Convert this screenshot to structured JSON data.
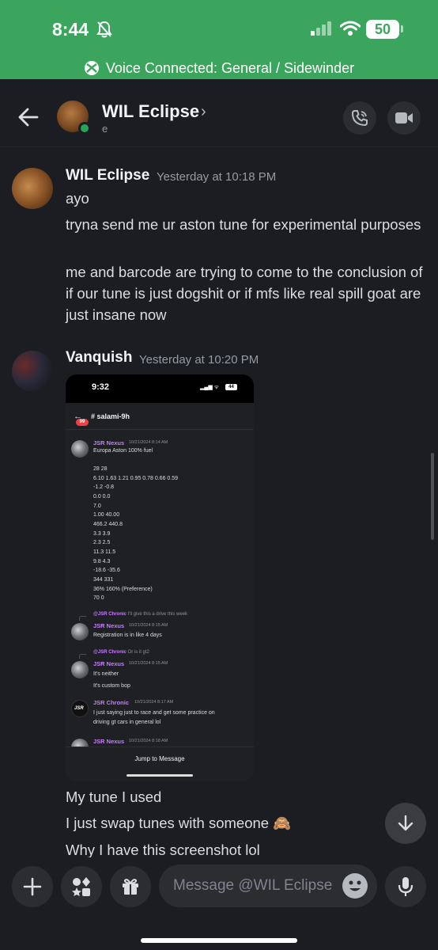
{
  "status_bar": {
    "time": "8:44",
    "battery": "50"
  },
  "voice": {
    "text": "Voice Connected: General / Sidewinder"
  },
  "header": {
    "name": "WIL Eclipse",
    "chevron": "›",
    "subtitle": "e"
  },
  "messages": [
    {
      "author": "WIL Eclipse",
      "timestamp": "Yesterday at 10:18 PM",
      "lines": [
        "ayo",
        "tryna send me ur aston tune for experimental purposes",
        "me and barcode are trying to come to the conclusion of if our tune is just dogshit or if mfs like real spill goat are just insane now"
      ]
    },
    {
      "author": "Vanquish",
      "timestamp": "Yesterday at 10:20 PM",
      "lines": [
        "My tune I used",
        "I just swap tunes with someone 🙈",
        "Why I have this screenshot lol"
      ]
    }
  ],
  "attachment": {
    "time": "9:32",
    "battery": "44",
    "badge": "99",
    "channel": "# salami-9h",
    "posts": [
      {
        "author": "JSR Nexus",
        "time": "10/21/2024 8:14 AM"
      },
      {
        "author": "JSR Nexus",
        "time": "10/21/2024 8:15 AM"
      },
      {
        "author": "JSR Nexus",
        "time": "10/21/2024 8:15 AM"
      },
      {
        "author": "JSR Chronic",
        "time": "10/21/2024 8:17 AM"
      },
      {
        "author": "JSR Nexus",
        "time": "10/21/2024 8:18 AM"
      }
    ],
    "tune_lines": [
      "Europa Aston 100% fuel",
      "",
      "28 28",
      "6.10 1.63 1.21 0.95 0.78 0.66 0.59",
      "-1.2 -0.8",
      "0.0 0.0",
      "7.0",
      "1.00 40.00",
      "466.2 440.8",
      "3.3 3.9",
      "2.3 2.5",
      "11.3 11.5",
      "9.8 4.3",
      "-18.6 -35.6",
      "344 331",
      "36% 160% (Preference)",
      "70 0"
    ],
    "reply1": {
      "mention": "@JSR Chronic",
      "text": "I'll give this a drive this week"
    },
    "post2_text": "Registration is in like 4 days",
    "reply2": {
      "mention": "@JSR Chronic",
      "text": "Or is it gt2"
    },
    "post3_text": [
      "It's neither",
      "It's custom bop"
    ],
    "post4_text": "I just saying just to race and get some practice on\ndriving gt cars in general lol",
    "jump_label": "Jump to Message"
  },
  "composer": {
    "placeholder": "Message @WIL Eclipse"
  },
  "colors": {
    "accent_green": "#3ba55d",
    "online": "#23a55a",
    "role_purple": "#c77dff"
  }
}
